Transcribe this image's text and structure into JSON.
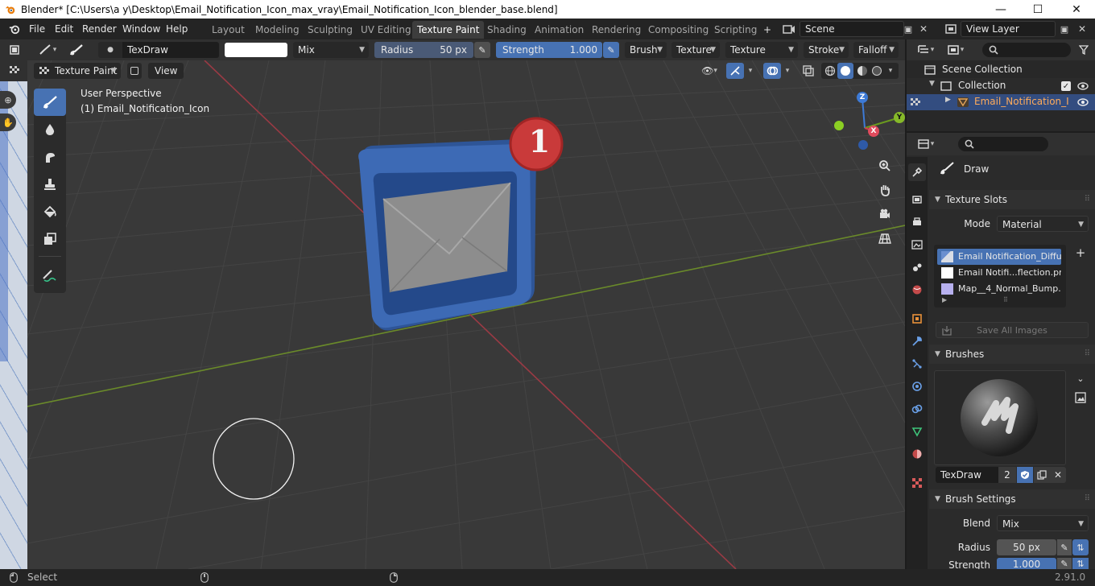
{
  "window": {
    "title": "Blender* [C:\\Users\\a y\\Desktop\\Email_Notification_Icon_max_vray\\Email_Notification_Icon_blender_base.blend]",
    "controls": {
      "minimize": "—",
      "maximize": "☐",
      "close": "✕"
    }
  },
  "menu": {
    "items": [
      "File",
      "Edit",
      "Render",
      "Window",
      "Help"
    ]
  },
  "workspaces": {
    "tabs": [
      "Layout",
      "Modeling",
      "Sculpting",
      "UV Editing",
      "Texture Paint",
      "Shading",
      "Animation",
      "Rendering",
      "Compositing",
      "Scripting"
    ],
    "active": "Texture Paint",
    "add": "+"
  },
  "scene": {
    "value": "Scene"
  },
  "view_layer": {
    "value": "View Layer"
  },
  "tool_header": {
    "brush_name": "TexDraw",
    "blend_mode": "Mix",
    "radius_label": "Radius",
    "radius_value": "50 px",
    "strength_label": "Strength",
    "strength_value": "1.000",
    "dropdowns": [
      "Brush",
      "Texture",
      "Texture Mask",
      "Stroke",
      "Falloff"
    ],
    "color": "#ffffff"
  },
  "view_header": {
    "mode": "Texture Paint",
    "view": "View"
  },
  "viewport": {
    "perspective": "User Perspective",
    "object": "(1) Email_Notification_Icon",
    "badge_number": "1",
    "axes": {
      "x": "X",
      "y": "Y",
      "z": "Z"
    }
  },
  "outliner": {
    "scene_collection": "Scene Collection",
    "collection": "Collection",
    "object": "Email_Notification_Ic"
  },
  "properties": {
    "active_tool": "Draw",
    "texture_slots": {
      "title": "Texture Slots",
      "mode_label": "Mode",
      "mode_value": "Material",
      "slots": [
        {
          "name": "Email Notification_Diffu...",
          "color": "#8aa7d4"
        },
        {
          "name": "Email Notifi...flection.png",
          "color": "#ffffff"
        },
        {
          "name": "Map__4_Normal_Bump....",
          "color": "#b7b0ee"
        }
      ],
      "save_all": "Save All Images"
    },
    "brushes": {
      "title": "Brushes",
      "brush_name": "TexDraw",
      "users": "2"
    },
    "brush_settings": {
      "title": "Brush Settings",
      "blend_label": "Blend",
      "blend_value": "Mix",
      "radius_label": "Radius",
      "radius_value": "50 px",
      "strength_label": "Strength",
      "strength_value": "1.000"
    }
  },
  "status": {
    "left": "Select",
    "version": "2.91.0"
  }
}
